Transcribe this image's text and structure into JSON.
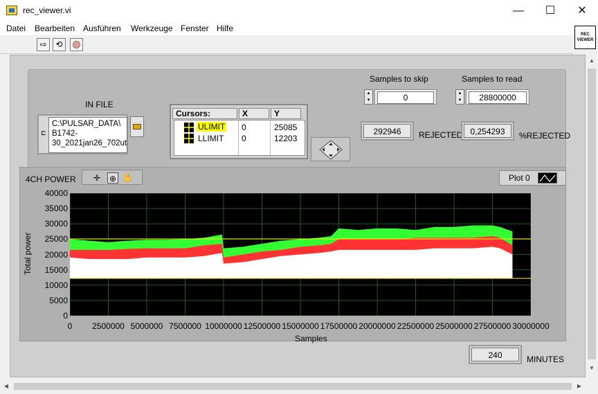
{
  "window": {
    "title": "rec_viewer.vi",
    "min": "—",
    "max": "☐",
    "close": "✕"
  },
  "menu": [
    "Datei",
    "Bearbeiten",
    "Ausführen",
    "Werkzeuge",
    "Fenster",
    "Hilfe"
  ],
  "vi_icon": {
    "line1": "REC",
    "line2": "VIEWER"
  },
  "in_file": {
    "label": "IN FILE",
    "path": "C:\\PULSAR_DATA\\ B1742-30_2021jan26_702ut"
  },
  "samples_to_skip": {
    "label": "Samples to skip",
    "value": "0"
  },
  "samples_to_read": {
    "label": "Samples to read",
    "value": "28800000"
  },
  "rejected": {
    "value": "292946",
    "label": "REJECTED"
  },
  "pct_rejected": {
    "value": "0,254293",
    "label": "%REJECTED"
  },
  "cursors": {
    "headers": [
      "Cursors:",
      "X",
      "Y"
    ],
    "rows": [
      {
        "name": "ULIMIT",
        "x": "0",
        "y": "25085",
        "highlight": "#ffff00"
      },
      {
        "name": "LLIMIT",
        "x": "0",
        "y": "12203"
      }
    ]
  },
  "graph": {
    "title": "4CH POWER",
    "legend": "Plot 0",
    "ylabel": "Total power",
    "xlabel": "Samples",
    "yticks": [
      "40000",
      "35000",
      "30000",
      "25000",
      "20000",
      "15000",
      "10000",
      "5000",
      "0"
    ],
    "xticks": [
      "0",
      "2500000",
      "5000000",
      "7500000",
      "10000000",
      "12500000",
      "15000000",
      "17500000",
      "20000000",
      "22500000",
      "25000000",
      "27500000",
      "30000000"
    ]
  },
  "minutes": {
    "value": "240",
    "label": "MINUTES"
  },
  "chart_data": {
    "type": "line",
    "xlabel": "Samples",
    "ylabel": "Total power",
    "xlim": [
      0,
      30000000
    ],
    "ylim": [
      0,
      40000
    ],
    "grid": true,
    "limits": {
      "ULIMIT": 25085,
      "LLIMIT": 12203
    },
    "x": [
      0,
      1250000,
      2500000,
      3750000,
      5000000,
      6250000,
      7500000,
      8750000,
      9900000,
      10000000,
      11250000,
      12500000,
      13750000,
      15000000,
      16250000,
      17000000,
      17500000,
      18750000,
      20000000,
      21250000,
      22500000,
      23750000,
      25000000,
      26250000,
      27500000,
      28000000,
      28800000
    ],
    "series": [
      {
        "color": "#33ff33",
        "values": [
          25000,
          24500,
          24000,
          24500,
          24800,
          24800,
          25000,
          25500,
          26500,
          22000,
          22500,
          23500,
          24500,
          25000,
          25500,
          26000,
          28500,
          28000,
          28500,
          28500,
          28000,
          29000,
          29000,
          29500,
          29500,
          29000,
          27500
        ]
      },
      {
        "color": "#ff3333",
        "values": [
          21500,
          21500,
          21500,
          21800,
          22000,
          22000,
          22000,
          23000,
          23500,
          19000,
          20000,
          21000,
          21500,
          22500,
          23000,
          23500,
          25000,
          25000,
          25000,
          25000,
          25500,
          25500,
          25500,
          25500,
          26000,
          25500,
          23000
        ]
      },
      {
        "color": "#ffffff",
        "values": [
          19000,
          18500,
          18500,
          18500,
          19000,
          19000,
          19000,
          19500,
          20500,
          17000,
          17500,
          18500,
          19500,
          20000,
          20500,
          21000,
          21500,
          21500,
          21500,
          21500,
          21500,
          22000,
          22000,
          22000,
          22500,
          22000,
          20000
        ]
      }
    ]
  }
}
